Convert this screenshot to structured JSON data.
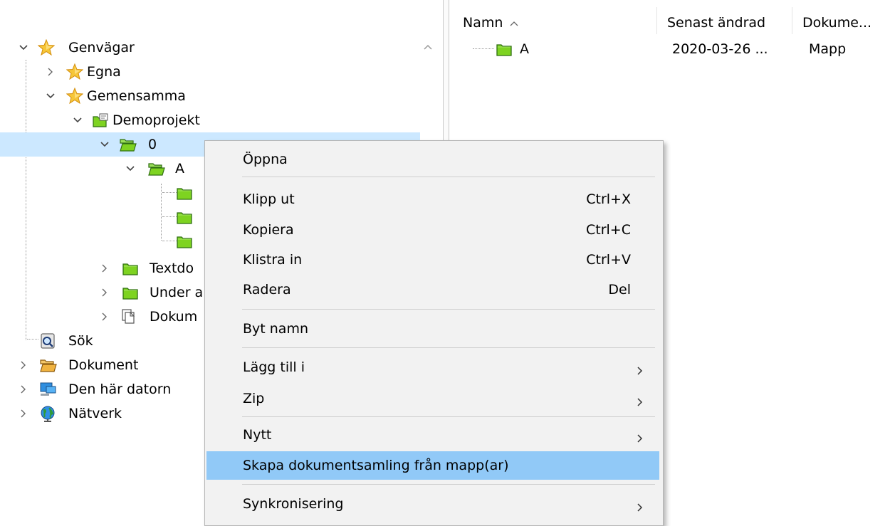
{
  "tree": {
    "items": [
      {
        "label": "Genvägar",
        "icon": "star-icon",
        "expanded": true
      },
      {
        "label": "Egna",
        "icon": "star-icon",
        "expanded": false
      },
      {
        "label": "Gemensamma",
        "icon": "star-icon",
        "expanded": true
      },
      {
        "label": "Demoprojekt",
        "icon": "project-folder-icon",
        "expanded": true
      },
      {
        "label": "0",
        "icon": "open-folder-icon",
        "expanded": true,
        "selected": true
      },
      {
        "label": "A",
        "icon": "open-folder-icon",
        "expanded": true
      },
      {
        "label": "",
        "icon": "green-folder-icon"
      },
      {
        "label": "",
        "icon": "green-folder-icon"
      },
      {
        "label": "",
        "icon": "green-folder-icon"
      },
      {
        "label": "Textdo",
        "icon": "green-folder-icon",
        "expanded": false
      },
      {
        "label": "Under a",
        "icon": "green-folder-icon",
        "expanded": false
      },
      {
        "label": "Dokum",
        "icon": "document-collection-icon",
        "expanded": false
      },
      {
        "label": "Sök",
        "icon": "search-icon"
      },
      {
        "label": "Dokument",
        "icon": "open-folder-icon",
        "expanded": false
      },
      {
        "label": "Den här datorn",
        "icon": "computer-icon",
        "expanded": false
      },
      {
        "label": "Nätverk",
        "icon": "network-globe-icon",
        "expanded": false
      }
    ]
  },
  "list": {
    "columns": [
      "Namn",
      "Senast ändrad",
      "Dokume..."
    ],
    "sort_column": "Namn",
    "rows": [
      {
        "name": "A",
        "modified": "2020-03-26 ...",
        "type": "Mapp"
      }
    ]
  },
  "context_menu": {
    "items": [
      {
        "label": "Öppna"
      },
      {
        "label": "Klipp ut",
        "shortcut": "Ctrl+X"
      },
      {
        "label": "Kopiera",
        "shortcut": "Ctrl+C"
      },
      {
        "label": "Klistra in",
        "shortcut": "Ctrl+V"
      },
      {
        "label": "Radera",
        "shortcut": "Del"
      },
      {
        "label": "Byt namn"
      },
      {
        "label": "Lägg till i",
        "submenu": true
      },
      {
        "label": "Zip",
        "submenu": true
      },
      {
        "label": "Nytt",
        "submenu": true
      },
      {
        "label": "Skapa dokumentsamling från mapp(ar)",
        "highlighted": true
      },
      {
        "label": "Synkronisering",
        "submenu": true
      }
    ]
  },
  "colors": {
    "selection": "#cce8ff",
    "menu_highlight": "#91c9f7",
    "menu_background": "#f2f2f2",
    "folder_green": "#7ed321",
    "star_gold": "#f5b91e"
  }
}
